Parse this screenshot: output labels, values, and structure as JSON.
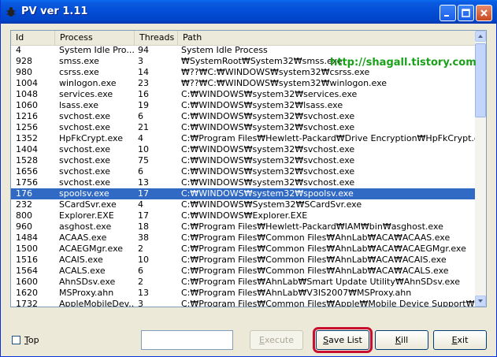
{
  "window": {
    "title": "PV ver 1.11"
  },
  "watermark": "http://shagall.tistory.com",
  "columns": {
    "id": "Id",
    "process": "Process",
    "threads": "Threads",
    "path": "Path"
  },
  "rows": [
    {
      "id": "4",
      "process": "System Idle Pro...",
      "threads": "94",
      "path": "System Idle Process"
    },
    {
      "id": "928",
      "process": "smss.exe",
      "threads": "3",
      "path": "₩SystemRoot₩System32₩smss.exe"
    },
    {
      "id": "980",
      "process": "csrss.exe",
      "threads": "14",
      "path": "₩??₩C:₩WINDOWS₩system32₩csrss.exe"
    },
    {
      "id": "1004",
      "process": "winlogon.exe",
      "threads": "23",
      "path": "₩??₩C:₩WINDOWS₩system32₩winlogon.exe"
    },
    {
      "id": "1048",
      "process": "services.exe",
      "threads": "16",
      "path": "C:₩WINDOWS₩system32₩services.exe"
    },
    {
      "id": "1060",
      "process": "lsass.exe",
      "threads": "19",
      "path": "C:₩WINDOWS₩system32₩lsass.exe"
    },
    {
      "id": "1216",
      "process": "svchost.exe",
      "threads": "6",
      "path": "C:₩WINDOWS₩system32₩svchost.exe"
    },
    {
      "id": "1256",
      "process": "svchost.exe",
      "threads": "21",
      "path": "C:₩WINDOWS₩system32₩svchost.exe"
    },
    {
      "id": "1352",
      "process": "HpFkCrypt.exe",
      "threads": "4",
      "path": "C:₩Program Files₩Hewlett-Packard₩Drive Encryption₩HpFkCrypt.exe"
    },
    {
      "id": "1404",
      "process": "svchost.exe",
      "threads": "10",
      "path": "C:₩WINDOWS₩system32₩svchost.exe"
    },
    {
      "id": "1528",
      "process": "svchost.exe",
      "threads": "75",
      "path": "C:₩WINDOWS₩system32₩svchost.exe"
    },
    {
      "id": "1656",
      "process": "svchost.exe",
      "threads": "6",
      "path": "C:₩WINDOWS₩system32₩svchost.exe"
    },
    {
      "id": "1756",
      "process": "svchost.exe",
      "threads": "13",
      "path": "C:₩WINDOWS₩system32₩svchost.exe"
    },
    {
      "id": "176",
      "process": "spoolsv.exe",
      "threads": "17",
      "path": "C:₩WINDOWS₩system32₩spoolsv.exe"
    },
    {
      "id": "232",
      "process": "SCardSvr.exe",
      "threads": "4",
      "path": "C:₩WINDOWS₩System32₩SCardSvr.exe"
    },
    {
      "id": "800",
      "process": "Explorer.EXE",
      "threads": "17",
      "path": "C:₩WINDOWS₩Explorer.EXE"
    },
    {
      "id": "960",
      "process": "asghost.exe",
      "threads": "18",
      "path": "C:₩Program Files₩Hewlett-Packard₩IAM₩bin₩asghost.exe"
    },
    {
      "id": "1484",
      "process": "ACAAS.exe",
      "threads": "38",
      "path": "C:₩Program Files₩Common Files₩AhnLab₩ACA₩ACAAS.exe"
    },
    {
      "id": "1500",
      "process": "ACAEGMgr.exe",
      "threads": "2",
      "path": "C:₩Program Files₩Common Files₩AhnLab₩ACA₩ACAEGMgr.exe"
    },
    {
      "id": "1516",
      "process": "ACAIS.exe",
      "threads": "10",
      "path": "C:₩Program Files₩Common Files₩AhnLab₩ACA₩ACAIS.exe"
    },
    {
      "id": "1564",
      "process": "ACALS.exe",
      "threads": "6",
      "path": "C:₩Program Files₩Common Files₩AhnLab₩ACA₩ACALS.exe"
    },
    {
      "id": "1600",
      "process": "AhnSDsv.exe",
      "threads": "2",
      "path": "C:₩Program Files₩AhnLab₩Smart Update Utility₩AhnSDsv.exe"
    },
    {
      "id": "1620",
      "process": "MSProxy.ahn",
      "threads": "13",
      "path": "C:₩Program Files₩AhnLab₩V3IS2007₩MSProxy.ahn"
    },
    {
      "id": "1732",
      "process": "AppleMobileDev...",
      "threads": "3",
      "path": "C:₩Program Files₩Common Files₩Apple₩Mobile Device Support₩bin₩AppleMobileDeviceService.exe"
    }
  ],
  "selected_row_index": 13,
  "controls": {
    "top_label": "Top",
    "top_checked": false,
    "command_value": "",
    "execute_label": "Execute",
    "save_list_label": "Save List",
    "kill_label": "Kill",
    "exit_label": "Exit"
  },
  "colors": {
    "selection": "#316ac5",
    "watermark": "#1aa01a",
    "highlight_box": "#c8102e"
  }
}
